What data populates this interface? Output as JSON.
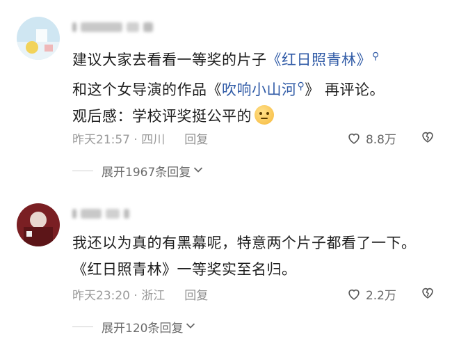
{
  "comments": [
    {
      "username_masked": "",
      "text_before_link1": "建议大家去看看一等奖的片子",
      "link1": "《红日照青林》",
      "text_line2_start": "和这个女导演的作品",
      "link2_open": "《",
      "link2": "吹响小山河",
      "link2_close": "》",
      "text_after_link2": "再评论。",
      "text_line3": "观后感：学校评奖挺公平的",
      "emoji_icon": "thinking-face-emoji",
      "time_location": "昨天21:57 · 四川",
      "reply_label": "回复",
      "like_count": "8.8万",
      "expand_label": "展开1967条回复"
    },
    {
      "username_masked": "",
      "text": "我还以为真的有黑幕呢，特意两个片子都看了一下。《红日照青林》一等奖实至名归。",
      "time_location": "昨天23:20 · 浙江",
      "reply_label": "回复",
      "like_count": "2.2万",
      "expand_label": "展开120条回复"
    }
  ],
  "colors": {
    "link": "#2f5aa6",
    "meta": "#9a9a9a",
    "text": "#1e1e1e"
  },
  "icons": [
    "search-icon",
    "heart-icon",
    "broken-heart-icon",
    "chevron-down-icon"
  ]
}
